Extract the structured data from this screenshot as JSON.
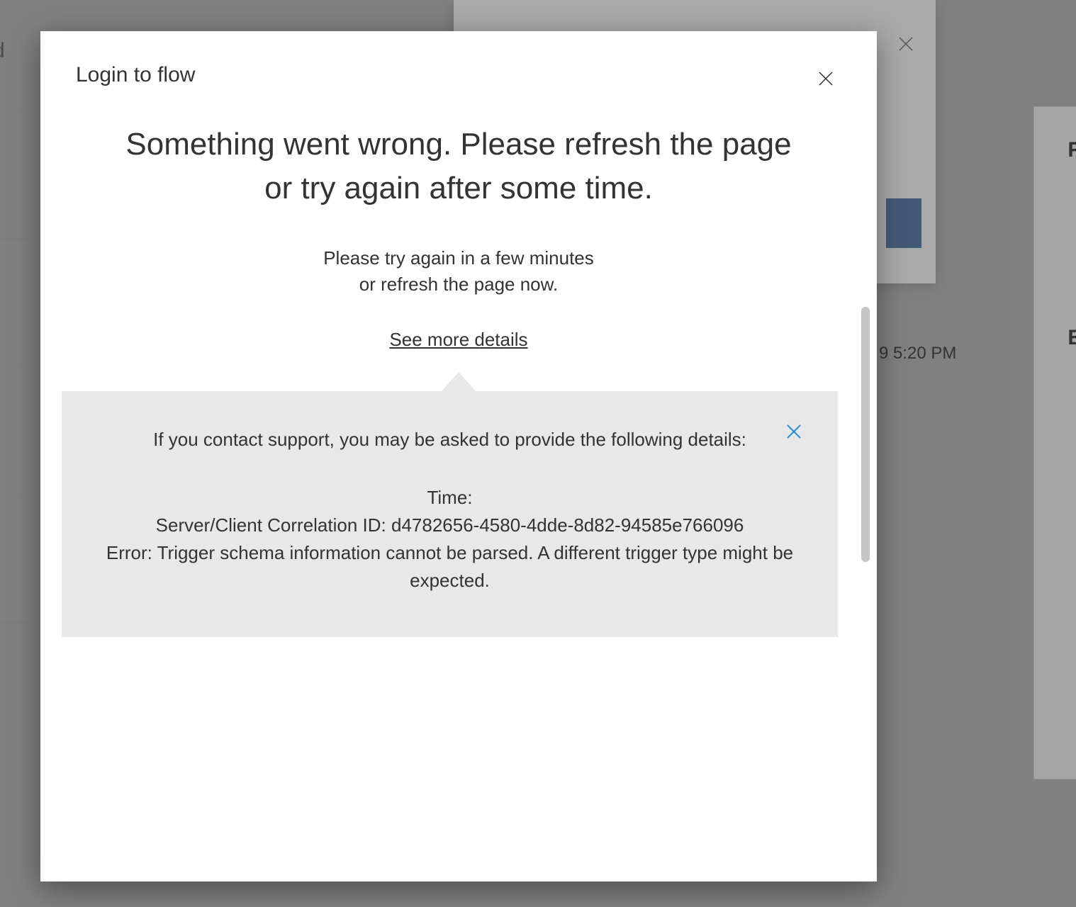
{
  "background": {
    "timestamp_partial": "9 5:20 PM",
    "left_char": "d",
    "right_text_1": "RE",
    "right_text_2": "EN"
  },
  "modal": {
    "title": "Login to flow",
    "error_heading": "Something went wrong. Please refresh the page or try again after some time.",
    "error_subtext_line1": "Please try again in a few minutes",
    "error_subtext_line2": "or refresh the page now.",
    "details_link": "See more details",
    "details": {
      "intro": "If you contact support, you may be asked to provide the following details:",
      "time_label": "Time:",
      "time_value": "",
      "correlation_label": "Server/Client Correlation ID:",
      "correlation_value": "d4782656-4580-4dde-8d82-94585e766096",
      "error_label": "Error:",
      "error_value": "Trigger schema information cannot be parsed. A different trigger type might be expected."
    }
  }
}
